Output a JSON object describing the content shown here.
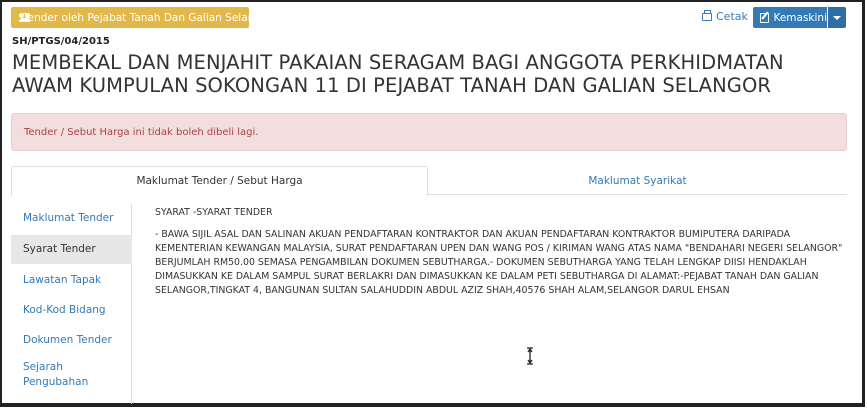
{
  "header": {
    "tender_button_label": "Tender oleh Pejabat Tanah Dan Galian Selangor",
    "print_label": "Cetak",
    "update_label": "Kemaskini"
  },
  "reference": "SH/PTGS/04/2015",
  "title": "MEMBEKAL DAN MENJAHIT PAKAIAN SERAGAM BAGI ANGGOTA PERKHIDMATAN AWAM KUMPULAN SOKONGAN 11 DI PEJABAT TANAH DAN GALIAN SELANGOR",
  "alert": "Tender / Sebut Harga ini tidak boleh dibeli lagi.",
  "tabs": [
    {
      "label": "Maklumat Tender / Sebut Harga",
      "active": true
    },
    {
      "label": "Maklumat Syarikat",
      "active": false
    }
  ],
  "sidebar": {
    "items": [
      {
        "label": "Maklumat Tender",
        "active": false
      },
      {
        "label": "Syarat Tender",
        "active": true
      },
      {
        "label": "Lawatan Tapak",
        "active": false
      },
      {
        "label": "Kod-Kod Bidang",
        "active": false
      },
      {
        "label": "Dokumen Tender",
        "active": false
      },
      {
        "label": "Sejarah Pengubahan",
        "active": false
      }
    ]
  },
  "content": {
    "heading": "SYARAT -SYARAT TENDER",
    "body": "- BAWA SIJIL ASAL DAN SALINAN AKUAN PENDAFTARAN KONTRAKTOR DAN AKUAN PENDAFTARAN KONTRAKTOR BUMIPUTERA DARIPADA KEMENTERIAN KEWANGAN MALAYSIA, SURAT PENDAFTARAN UPEN DAN WANG POS / KIRIMAN WANG ATAS NAMA \"BENDAHARI NEGERI SELANGOR\" BERJUMLAH RM50.00 SEMASA PENGAMBILAN DOKUMEN SEBUTHARGA.- DOKUMEN SEBUTHARGA YANG TELAH LENGKAP DIISI HENDAKLAH DIMASUKKAN KE DALAM SAMPUL SURAT BERLAKRI DAN DIMASUKKAN KE DALAM PETI SEBUTHARGA DI ALAMAT:-PEJABAT TANAH DAN GALIAN SELANGOR,TINGKAT 4, BANGUNAN SULTAN SALAHUDDIN ABDUL AZIZ SHAH,40576 SHAH ALAM,SELANGOR DARUL EHSAN"
  },
  "colors": {
    "warning_button": "#e2b84a",
    "primary": "#337ab7",
    "alert_bg": "#f2dede",
    "alert_text": "#a94442",
    "active_side_bg": "#e7e7e7"
  },
  "icons": [
    "users-icon",
    "print-icon",
    "edit-icon",
    "caret-down-icon",
    "text-cursor-icon"
  ]
}
